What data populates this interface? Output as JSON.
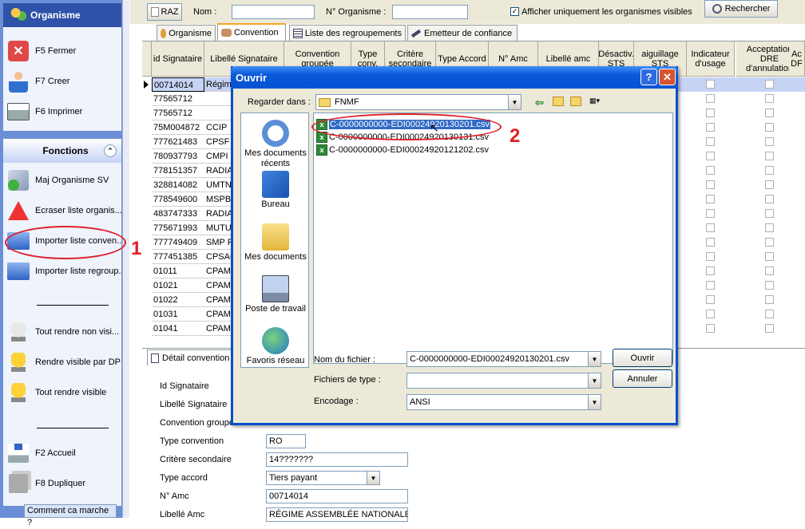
{
  "sidebar": {
    "panel1_title": "Organisme",
    "panel1_items": [
      "F5 Fermer",
      "F7 Creer",
      "F6 Imprimer"
    ],
    "panel2_title": "Fonctions",
    "panel2_items": [
      "Maj Organisme SV",
      "Ecraser liste organis...",
      "Importer liste conven...",
      "Importer liste regroup..."
    ],
    "panel2_items_b": [
      "Tout rendre non visi...",
      "Rendre visible par DP",
      "Tout rendre visible"
    ],
    "panel2_items_c": [
      "F2 Accueil",
      "F8 Dupliquer"
    ],
    "help": "Comment ca marche ?"
  },
  "toolbar": {
    "raz": "RAZ",
    "nom_label": "Nom :",
    "norg_label": "N° Organisme :",
    "visible_label": "Afficher uniquement les organismes visibles",
    "rechercher": "Rechercher"
  },
  "tabs": [
    "Organisme",
    "Convention",
    "Liste des regroupements",
    "Emetteur de confiance"
  ],
  "grid": {
    "headers": [
      "id Signataire",
      "Libellé Signataire",
      "Convention groupée",
      "Type conv.",
      "Critère secondaire",
      "Type Accord",
      "N° Amc",
      "Libellé amc",
      "Désactiv. STS",
      "aiguillage STS",
      "Indicateur d'usage",
      "Acceptation DRE d'annulation",
      "Ac DF"
    ],
    "rows": [
      [
        "00714014",
        "Régime"
      ],
      [
        "77565712",
        ""
      ],
      [
        "77565712",
        ""
      ],
      [
        "75M004872",
        "CCIP"
      ],
      [
        "777621483",
        "CPSF N"
      ],
      [
        "780937793",
        "CMPI R"
      ],
      [
        "778151357",
        "RADIA"
      ],
      [
        "328814082",
        "UMTNS"
      ],
      [
        "778549600",
        "MSPB F"
      ],
      [
        "483747333",
        "RADIA"
      ],
      [
        "775671993",
        "MUTUE"
      ],
      [
        "777749409",
        "SMP RA"
      ],
      [
        "777451385",
        "CPSAC"
      ],
      [
        "01011",
        "CPAM"
      ],
      [
        "01021",
        "CPAM"
      ],
      [
        "01022",
        "CPAM"
      ],
      [
        "01031",
        "CPAM"
      ],
      [
        "01041",
        "CPAM"
      ]
    ]
  },
  "detail": {
    "tab": "Détail convention",
    "labels": [
      "Id Signataire",
      "Libellé Signataire",
      "Convention groupée",
      "Type convention",
      "Critère secondaire",
      "Type accord",
      "N° Amc",
      "Libellé Amc"
    ],
    "type_convention": "RO",
    "critere": "14???????",
    "type_accord": "Tiers payant",
    "amc": "00714014",
    "libelle_amc": "RÉGIME ASSEMBLÉE NATIONALE"
  },
  "dialog": {
    "title": "Ouvrir",
    "lookin_label": "Regarder dans :",
    "lookin_value": "FNMF",
    "places": [
      "Mes documents récents",
      "Bureau",
      "Mes documents",
      "Poste de travail",
      "Favoris réseau"
    ],
    "files": [
      "C-0000000000-EDI00024920130201.csv",
      "C-0000000000-EDI00024920130131.csv",
      "C-0000000000-EDI00024920121202.csv"
    ],
    "filename_label": "Nom du fichier :",
    "filename_value": "C-0000000000-EDI00024920130201.csv",
    "filetype_label": "Fichiers de type :",
    "filetype_value": "",
    "encoding_label": "Encodage :",
    "encoding_value": "ANSI",
    "open": "Ouvrir",
    "cancel": "Annuler"
  },
  "annotations": [
    "1",
    "2"
  ],
  "colors": {
    "accent": "#0a4fc9",
    "sidebar": "#6b8fd6",
    "highlight": "#e0202a"
  }
}
